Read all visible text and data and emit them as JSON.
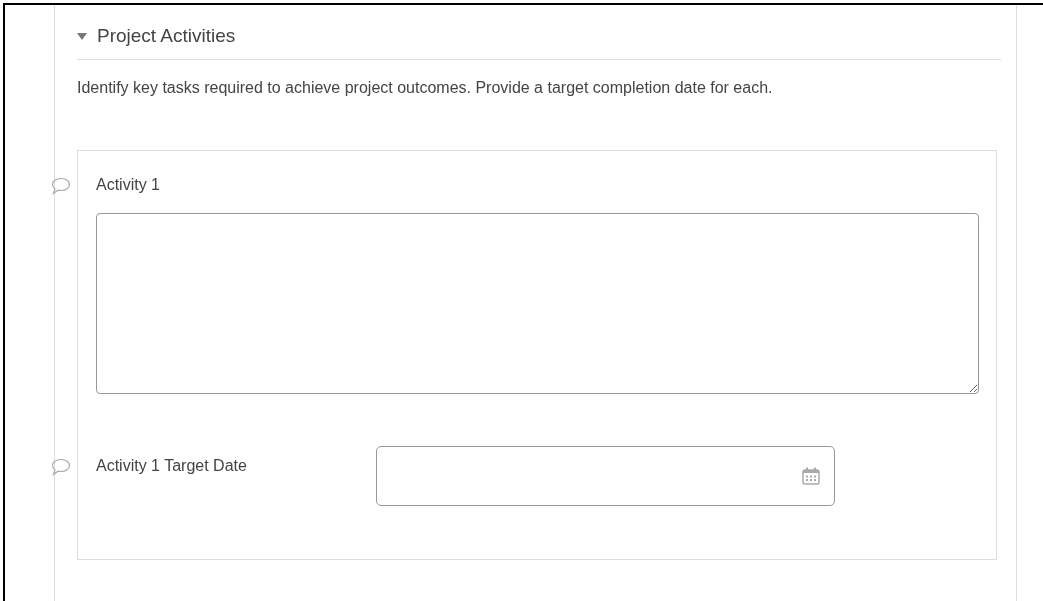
{
  "section": {
    "title": "Project Activities",
    "expanded": true,
    "description": "Identify key tasks required to achieve project outcomes. Provide a target completion date for each."
  },
  "fields": [
    {
      "kind": "textarea",
      "label": "Activity 1"
    },
    {
      "kind": "date",
      "label": "Activity 1 Target Date"
    }
  ]
}
